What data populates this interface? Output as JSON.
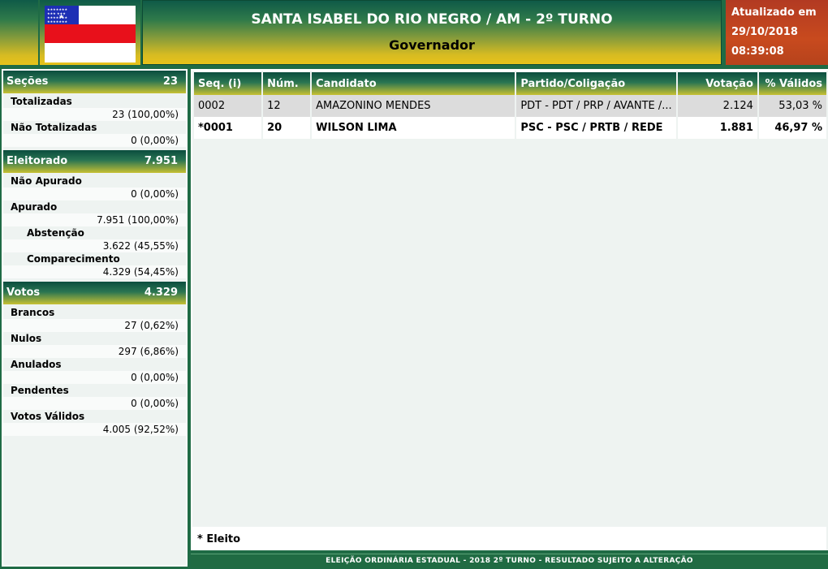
{
  "header": {
    "title": "SANTA ISABEL DO RIO NEGRO / AM - 2º TURNO",
    "subtitle": "Governador",
    "update_label": "Atualizado em",
    "update_date": "29/10/2018",
    "update_time": "08:39:08"
  },
  "sidebar": {
    "secoes": {
      "label": "Seções",
      "total": "23",
      "items": [
        {
          "label": "Totalizadas",
          "value": "23 (100,00%)"
        },
        {
          "label": "Não Totalizadas",
          "value": "0 (0,00%)"
        }
      ]
    },
    "eleitorado": {
      "label": "Eleitorado",
      "total": "7.951",
      "items": [
        {
          "label": "Não Apurado",
          "value": "0 (0,00%)"
        },
        {
          "label": "Apurado",
          "value": "7.951 (100,00%)"
        },
        {
          "label": "Abstenção",
          "value": "3.622 (45,55%)"
        },
        {
          "label": "Comparecimento",
          "value": "4.329 (54,45%)"
        }
      ]
    },
    "votos": {
      "label": "Votos",
      "total": "4.329",
      "items": [
        {
          "label": "Brancos",
          "value": "27 (0,62%)"
        },
        {
          "label": "Nulos",
          "value": "297 (6,86%)"
        },
        {
          "label": "Anulados",
          "value": "0 (0,00%)"
        },
        {
          "label": "Pendentes",
          "value": "0 (0,00%)"
        },
        {
          "label": "Votos Válidos",
          "value": "4.005 (92,52%)"
        }
      ]
    }
  },
  "table": {
    "columns": [
      "Seq.  (i)",
      "Núm.",
      "Candidato",
      "Partido/Coligação",
      "Votação",
      "% Válidos"
    ],
    "rows": [
      {
        "seq": "0002",
        "num": "12",
        "candidato": "AMAZONINO MENDES",
        "partido": "PDT - PDT / PRP / AVANTE /...",
        "votacao": "2.124",
        "validos": "53,03 %"
      },
      {
        "seq": "*0001",
        "num": "20",
        "candidato": "WILSON LIMA",
        "partido": "PSC - PSC / PRTB / REDE",
        "votacao": "1.881",
        "validos": "46,97 %"
      }
    ]
  },
  "legend": "* Eleito",
  "footer": "ELEIÇÃO ORDINÁRIA ESTADUAL - 2018 2º TURNO - RESULTADO SUJEITO A ALTERAÇÃO",
  "colors": {
    "header_green": "#0f5a48",
    "header_gold": "#e8c21a",
    "update_red": "#b23a22",
    "page_green": "#1f6b45"
  }
}
